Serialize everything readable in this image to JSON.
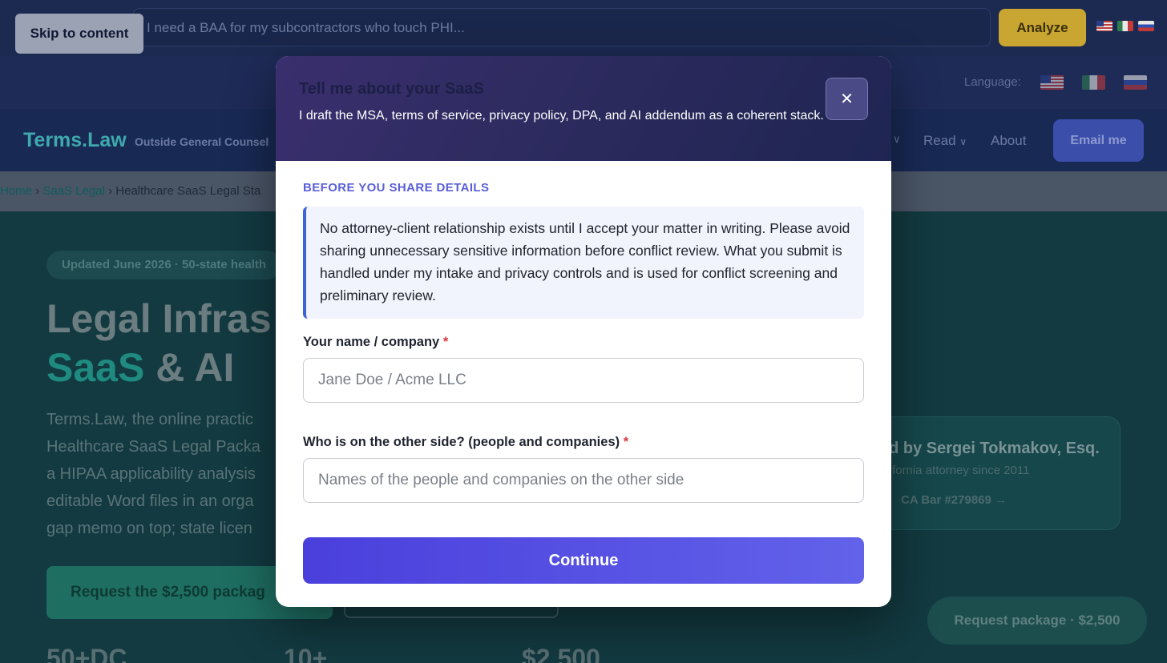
{
  "skip_link": "Skip to content",
  "topbar": {
    "search_placeholder": "I need a BAA for my subcontractors who touch PHI...",
    "analyze_label": "Analyze"
  },
  "language_bar": {
    "label": "Language:"
  },
  "navbar": {
    "brand": "Terms.Law",
    "brand_sub": "Outside General Counsel",
    "read_label": "Read",
    "about_label": "About",
    "email_label": "Email me",
    "chevron": "∨"
  },
  "breadcrumb": {
    "home": "Home",
    "sep": "›",
    "saas": "SaaS Legal",
    "current": "Healthcare SaaS Legal Sta"
  },
  "hero": {
    "pill": "Updated June 2026 · 50-state health",
    "h1_line1": "Legal Infras",
    "h1_accent": "SaaS",
    "h1_rest": "& AI",
    "lead": [
      "Terms.Law, the online practic",
      "Healthcare SaaS Legal Packa",
      "a HIPAA applicability analysis",
      "editable Word files in an orga",
      "gap memo on top; state licen"
    ],
    "request_label": "Request the $2,500 packag",
    "stats": [
      "50+DC",
      "10+",
      "$2,500"
    ]
  },
  "attorney_card": {
    "name": "ed by Sergei Tokmakov, Esq.",
    "since": "fornia attorney since 2011",
    "bar": "CA Bar #279869 →"
  },
  "floating_cta": "Request package · $2,500",
  "modal": {
    "title": "Tell me about your SaaS",
    "subtitle": "I draft the MSA, terms of service, privacy policy, DPA, and AI addendum as a coherent stack.",
    "close_glyph": "✕",
    "section_label": "BEFORE YOU SHARE DETAILS",
    "notice": "No attorney-client relationship exists until I accept your matter in writing. Please avoid sharing unnecessary sensitive information before conflict review. What you submit is handled under my intake and privacy controls and is used for conflict screening and preliminary review.",
    "name_label": "Your name / company",
    "name_placeholder": "Jane Doe / Acme LLC",
    "other_label": "Who is on the other side? (people and companies)",
    "other_placeholder": "Names of the people and companies on the other side",
    "required_mark": "*",
    "continue_label": "Continue"
  },
  "colors": {
    "modal_accent": "#4f46e5",
    "required": "#e0373e",
    "brand_teal": "#1f8a7f"
  }
}
